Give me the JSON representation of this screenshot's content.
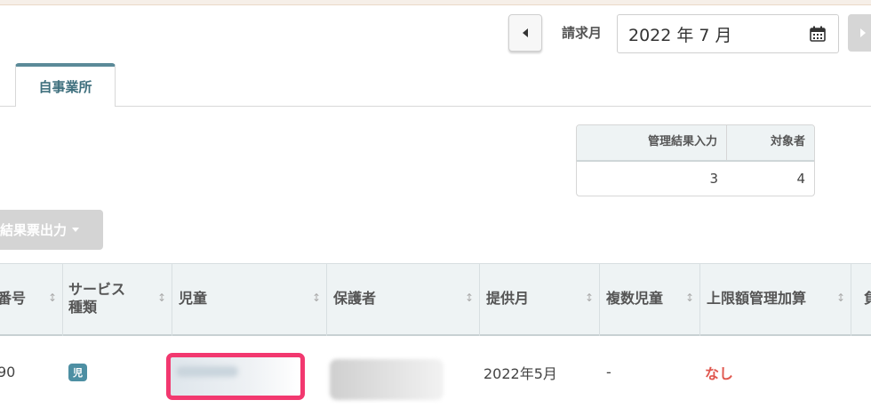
{
  "header": {
    "month_label": "請求月",
    "month_value": "2022 年 7 月"
  },
  "tabs": [
    {
      "label": "自事業所"
    }
  ],
  "summary": {
    "headers": [
      "管理結果入力",
      "対象者"
    ],
    "values": [
      "3",
      "4"
    ]
  },
  "export_button": {
    "label": "結果票出力"
  },
  "table": {
    "columns": [
      "番号",
      "サービス\n種類",
      "児童",
      "保護者",
      "提供月",
      "複数児童",
      "上限額管理加算",
      "負"
    ],
    "rows": [
      {
        "number": "90",
        "service_badge": "児",
        "provision_month": "2022年5月",
        "multiple_children": "-",
        "upper_limit_addition": "なし"
      }
    ]
  },
  "colors": {
    "accent": "#4d8fa3",
    "tab_border": "#5b8a98",
    "highlight": "#f2386f",
    "warning_text": "#e0584f"
  },
  "icons": [
    "caret-left-icon",
    "calendar-icon",
    "caret-right-icon",
    "sort-icon",
    "dropdown-caret-icon"
  ]
}
